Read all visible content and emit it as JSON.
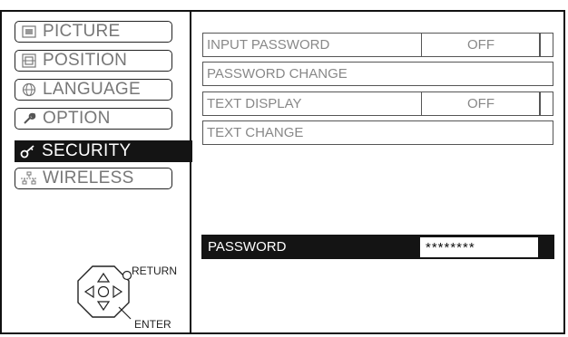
{
  "sidebar": {
    "items": [
      {
        "label": "PICTURE",
        "icon": "picture-icon"
      },
      {
        "label": "POSITION",
        "icon": "position-icon"
      },
      {
        "label": "LANGUAGE",
        "icon": "globe-icon"
      },
      {
        "label": "OPTION",
        "icon": "wrench-icon"
      },
      {
        "label": "SECURITY",
        "icon": "key-icon"
      },
      {
        "label": "WIRELESS",
        "icon": "network-icon"
      }
    ],
    "active": "SECURITY"
  },
  "menu": {
    "rows": [
      {
        "label": "INPUT PASSWORD",
        "value": "OFF"
      },
      {
        "label": "PASSWORD CHANGE"
      },
      {
        "label": "TEXT DISPLAY",
        "value": "OFF"
      },
      {
        "label": "TEXT CHANGE"
      }
    ]
  },
  "password": {
    "label": "PASSWORD",
    "value": "********"
  },
  "nav": {
    "return_label": "RETURN",
    "enter_label": "ENTER"
  }
}
